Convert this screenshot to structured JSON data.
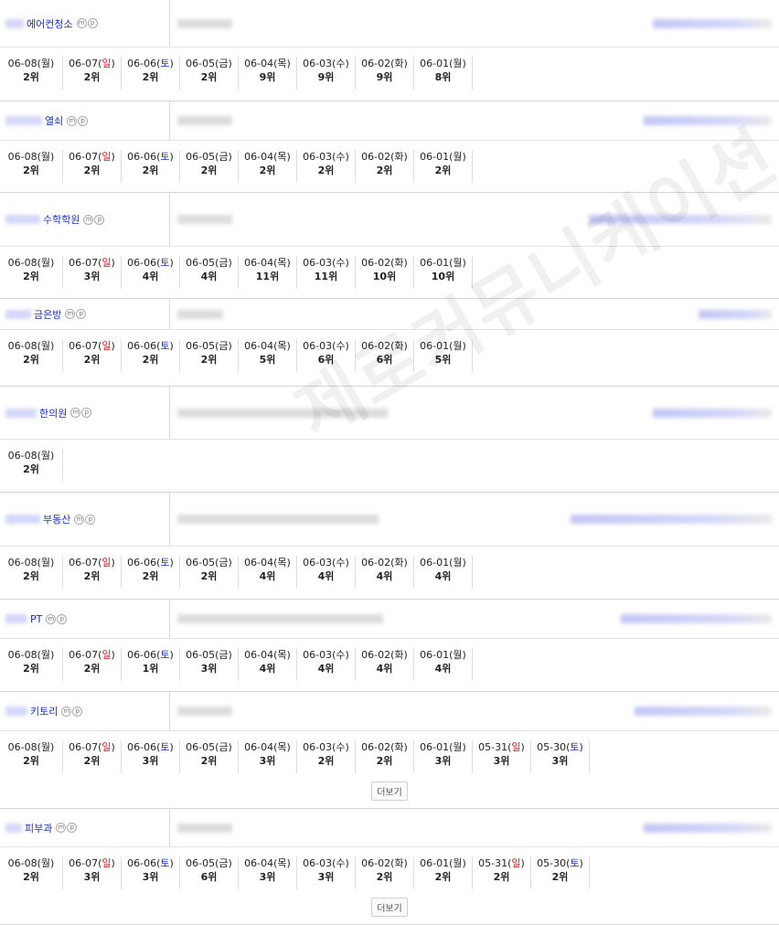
{
  "watermark": "제로커뮤니케이션",
  "more_label": "더보기",
  "badges": [
    "m",
    "p"
  ],
  "keywords": [
    {
      "keyword": "에어컨청소",
      "ranks": [
        {
          "date": "06-08",
          "day": "월",
          "rank": "2위"
        },
        {
          "date": "06-07",
          "day": "일",
          "rank": "2위"
        },
        {
          "date": "06-06",
          "day": "토",
          "rank": "2위"
        },
        {
          "date": "06-05",
          "day": "금",
          "rank": "2위"
        },
        {
          "date": "06-04",
          "day": "목",
          "rank": "9위"
        },
        {
          "date": "06-03",
          "day": "수",
          "rank": "9위"
        },
        {
          "date": "06-02",
          "day": "화",
          "rank": "9위"
        },
        {
          "date": "06-01",
          "day": "월",
          "rank": "8위"
        }
      ]
    },
    {
      "keyword": "열쇠",
      "ranks": [
        {
          "date": "06-08",
          "day": "월",
          "rank": "2위"
        },
        {
          "date": "06-07",
          "day": "일",
          "rank": "2위"
        },
        {
          "date": "06-06",
          "day": "토",
          "rank": "2위"
        },
        {
          "date": "06-05",
          "day": "금",
          "rank": "2위"
        },
        {
          "date": "06-04",
          "day": "목",
          "rank": "2위"
        },
        {
          "date": "06-03",
          "day": "수",
          "rank": "2위"
        },
        {
          "date": "06-02",
          "day": "화",
          "rank": "2위"
        },
        {
          "date": "06-01",
          "day": "월",
          "rank": "2위"
        }
      ]
    },
    {
      "keyword": "수학학원",
      "ranks": [
        {
          "date": "06-08",
          "day": "월",
          "rank": "2위"
        },
        {
          "date": "06-07",
          "day": "일",
          "rank": "3위"
        },
        {
          "date": "06-06",
          "day": "토",
          "rank": "4위"
        },
        {
          "date": "06-05",
          "day": "금",
          "rank": "4위"
        },
        {
          "date": "06-04",
          "day": "목",
          "rank": "11위"
        },
        {
          "date": "06-03",
          "day": "수",
          "rank": "11위"
        },
        {
          "date": "06-02",
          "day": "화",
          "rank": "10위"
        },
        {
          "date": "06-01",
          "day": "월",
          "rank": "10위"
        }
      ]
    },
    {
      "keyword": "금은방",
      "ranks": [
        {
          "date": "06-08",
          "day": "월",
          "rank": "2위"
        },
        {
          "date": "06-07",
          "day": "일",
          "rank": "2위"
        },
        {
          "date": "06-06",
          "day": "토",
          "rank": "2위"
        },
        {
          "date": "06-05",
          "day": "금",
          "rank": "2위"
        },
        {
          "date": "06-04",
          "day": "목",
          "rank": "5위"
        },
        {
          "date": "06-03",
          "day": "수",
          "rank": "6위"
        },
        {
          "date": "06-02",
          "day": "화",
          "rank": "6위"
        },
        {
          "date": "06-01",
          "day": "월",
          "rank": "5위"
        }
      ]
    },
    {
      "keyword": "한의원",
      "ranks": [
        {
          "date": "06-08",
          "day": "월",
          "rank": "2위"
        }
      ]
    },
    {
      "keyword": "부동산",
      "ranks": [
        {
          "date": "06-08",
          "day": "월",
          "rank": "2위"
        },
        {
          "date": "06-07",
          "day": "일",
          "rank": "2위"
        },
        {
          "date": "06-06",
          "day": "토",
          "rank": "2위"
        },
        {
          "date": "06-05",
          "day": "금",
          "rank": "2위"
        },
        {
          "date": "06-04",
          "day": "목",
          "rank": "4위"
        },
        {
          "date": "06-03",
          "day": "수",
          "rank": "4위"
        },
        {
          "date": "06-02",
          "day": "화",
          "rank": "4위"
        },
        {
          "date": "06-01",
          "day": "월",
          "rank": "4위"
        }
      ]
    },
    {
      "keyword": "PT",
      "ranks": [
        {
          "date": "06-08",
          "day": "월",
          "rank": "2위"
        },
        {
          "date": "06-07",
          "day": "일",
          "rank": "2위"
        },
        {
          "date": "06-06",
          "day": "토",
          "rank": "1위"
        },
        {
          "date": "06-05",
          "day": "금",
          "rank": "3위"
        },
        {
          "date": "06-04",
          "day": "목",
          "rank": "4위"
        },
        {
          "date": "06-03",
          "day": "수",
          "rank": "4위"
        },
        {
          "date": "06-02",
          "day": "화",
          "rank": "4위"
        },
        {
          "date": "06-01",
          "day": "월",
          "rank": "4위"
        }
      ]
    },
    {
      "keyword": "키토리",
      "more": true,
      "ranks": [
        {
          "date": "06-08",
          "day": "월",
          "rank": "2위"
        },
        {
          "date": "06-07",
          "day": "일",
          "rank": "2위"
        },
        {
          "date": "06-06",
          "day": "토",
          "rank": "3위"
        },
        {
          "date": "06-05",
          "day": "금",
          "rank": "2위"
        },
        {
          "date": "06-04",
          "day": "목",
          "rank": "3위"
        },
        {
          "date": "06-03",
          "day": "수",
          "rank": "2위"
        },
        {
          "date": "06-02",
          "day": "화",
          "rank": "2위"
        },
        {
          "date": "06-01",
          "day": "월",
          "rank": "3위"
        },
        {
          "date": "05-31",
          "day": "일",
          "rank": "3위"
        },
        {
          "date": "05-30",
          "day": "토",
          "rank": "3위"
        }
      ]
    },
    {
      "keyword": "피부과",
      "more": true,
      "ranks": [
        {
          "date": "06-08",
          "day": "월",
          "rank": "2위"
        },
        {
          "date": "06-07",
          "day": "일",
          "rank": "3위"
        },
        {
          "date": "06-06",
          "day": "토",
          "rank": "3위"
        },
        {
          "date": "06-05",
          "day": "금",
          "rank": "6위"
        },
        {
          "date": "06-04",
          "day": "목",
          "rank": "3위"
        },
        {
          "date": "06-03",
          "day": "수",
          "rank": "3위"
        },
        {
          "date": "06-02",
          "day": "화",
          "rank": "2위"
        },
        {
          "date": "06-01",
          "day": "월",
          "rank": "2위"
        },
        {
          "date": "05-31",
          "day": "일",
          "rank": "2위"
        },
        {
          "date": "05-30",
          "day": "토",
          "rank": "2위"
        }
      ]
    }
  ]
}
